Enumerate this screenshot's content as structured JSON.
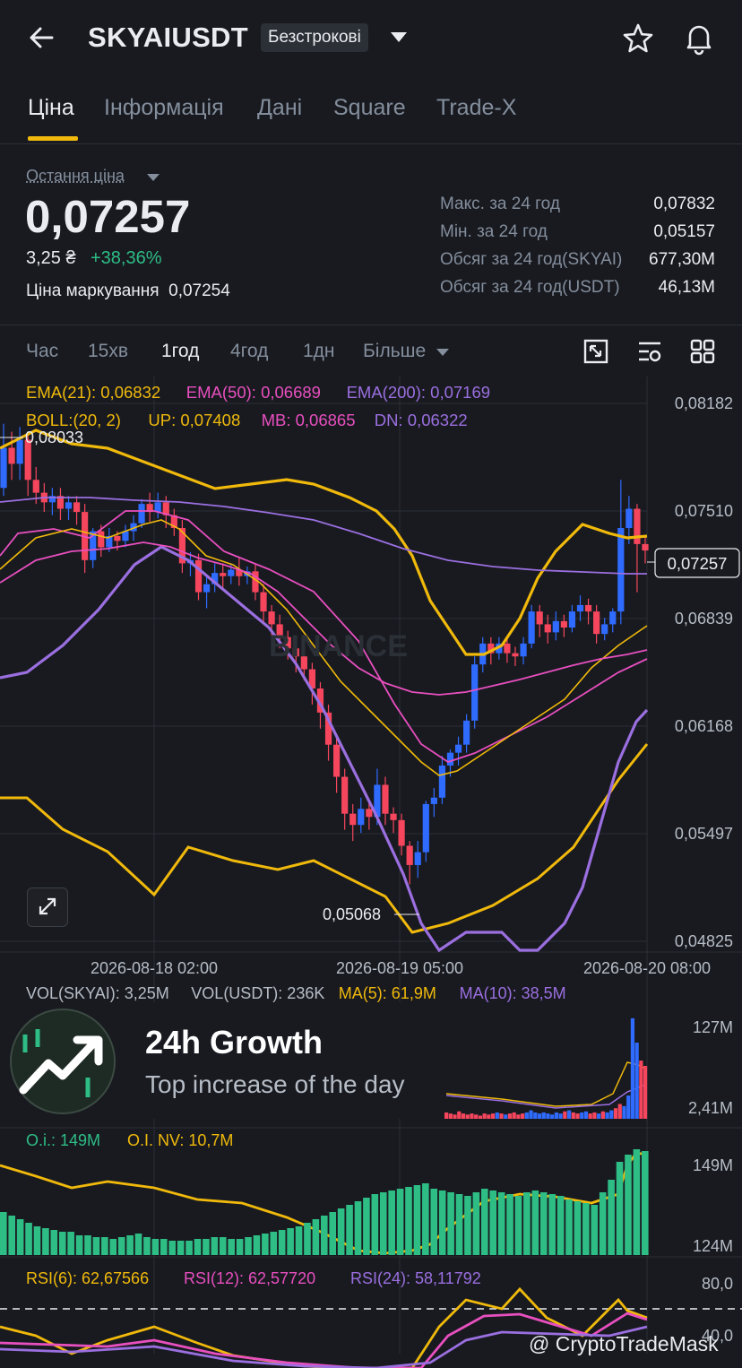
{
  "header": {
    "symbol": "SKYAIUSDT",
    "contract_type": "Безстрокові",
    "icons": [
      "back-arrow-icon",
      "chevron-down-icon",
      "star-icon",
      "bell-icon"
    ]
  },
  "tabs": [
    {
      "label": "Ціна",
      "active": true
    },
    {
      "label": "Інформація",
      "active": false
    },
    {
      "label": "Дані",
      "active": false
    },
    {
      "label": "Square",
      "active": false
    },
    {
      "label": "Trade-X",
      "active": false
    }
  ],
  "ticker": {
    "last_price_label": "Остання ціна",
    "last_price": "0,07257",
    "price_uah": "3,25 ₴",
    "change_pct": "+38,36%",
    "mark_price_label": "Ціна маркування",
    "mark_price": "0,07254",
    "stats": [
      {
        "label": "Макс. за 24 год",
        "value": "0,07832"
      },
      {
        "label": "Мін. за 24 год",
        "value": "0,05157"
      },
      {
        "label": "Обсяг за 24 год(SKYAI)",
        "value": "677,30M"
      },
      {
        "label": "Обсяг за 24 год(USDT)",
        "value": "46,13M"
      }
    ]
  },
  "intervals": {
    "items": [
      "Час",
      "15хв",
      "1год",
      "4год",
      "1дн",
      "Більше"
    ],
    "active": "1год",
    "tool_icons": [
      "chart-settings-icon",
      "indicator-icon",
      "layout-grid-icon"
    ]
  },
  "main_chart": {
    "ema_legend": [
      {
        "text": "EMA(21): 0,06832",
        "color": "#f0b90b"
      },
      {
        "text": "EMA(50): 0,06689",
        "color": "#e84fbf"
      },
      {
        "text": "EMA(200): 0,07169",
        "color": "#9b6fe0"
      }
    ],
    "boll_legend": [
      {
        "text": "BOLL:(20, 2)",
        "color": "#f0b90b"
      },
      {
        "text": "UP: 0,07408",
        "color": "#f0b90b"
      },
      {
        "text": "MB: 0,06865",
        "color": "#e84fbf"
      },
      {
        "text": "DN: 0,06322",
        "color": "#9b6fe0"
      }
    ],
    "y_ticks": [
      "0,08182",
      "0,07510",
      "0,06839",
      "0,06168",
      "0,05497",
      "0,04825"
    ],
    "x_ticks": [
      "2026-08-18 02:00",
      "2026-08-19 05:00",
      "2026-08-20 08:00"
    ],
    "high_marker": "0,08033",
    "low_marker": "0,05068",
    "current_price_tag": "0,07257",
    "watermark": "BINANCE",
    "colors": {
      "up": "#2f6bff",
      "down": "#f6465d",
      "grid": "#2b2f36"
    }
  },
  "volume_panel": {
    "legend": [
      {
        "text": "VOL(SKYAI): 3,25M",
        "color": "#b7bdc6"
      },
      {
        "text": "VOL(USDT): 236K",
        "color": "#b7bdc6"
      },
      {
        "text": "MA(5): 61,9M",
        "color": "#f0b90b"
      },
      {
        "text": "MA(10): 38,5M",
        "color": "#9b6fe0"
      }
    ],
    "y_ticks": [
      "127M",
      "2,41M"
    ]
  },
  "promo": {
    "title": "24h Growth",
    "subtitle": "Top increase of the day"
  },
  "oi_panel": {
    "legend": [
      {
        "text": "O.i.: 149M",
        "color": "#2ebd85"
      },
      {
        "text": "O.I. NV: 10,7M",
        "color": "#f0b90b"
      }
    ],
    "y_ticks": [
      "149M",
      "124M"
    ]
  },
  "rsi_panel": {
    "legend": [
      {
        "text": "RSI(6): 62,67566",
        "color": "#f0b90b"
      },
      {
        "text": "RSI(12): 62,57720",
        "color": "#e84fbf"
      },
      {
        "text": "RSI(24): 58,11792",
        "color": "#9b6fe0"
      }
    ],
    "y_ticks": [
      "80,0",
      "40,0"
    ]
  },
  "footer": {
    "watermark": "@ CryptoTradeMask"
  }
}
